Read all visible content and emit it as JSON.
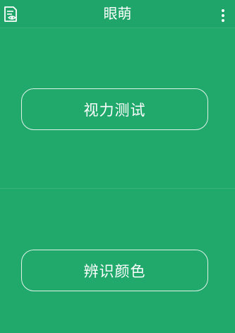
{
  "header": {
    "title": "眼萌",
    "left_icon": "eye-document-icon",
    "right_icon": "more-vertical-icon"
  },
  "main": {
    "vision_test_label": "视力测试",
    "color_identify_label": "辨识颜色"
  },
  "colors": {
    "background": "#21a86b",
    "text": "#ffffff",
    "button_border": "#e8f6ee"
  }
}
